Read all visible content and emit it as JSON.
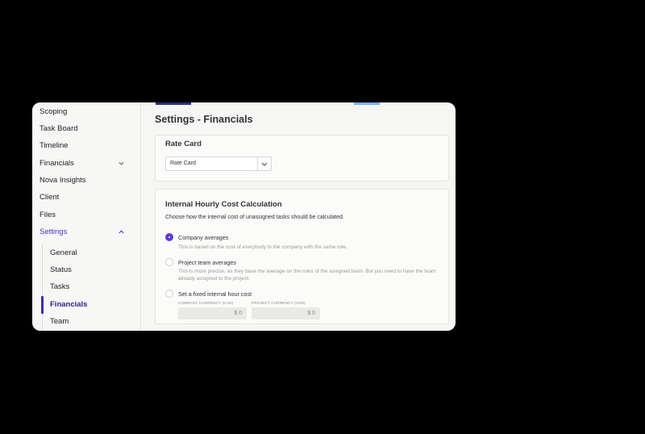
{
  "sidebar": {
    "items": [
      {
        "label": "Scoping"
      },
      {
        "label": "Task Board"
      },
      {
        "label": "Timeline"
      },
      {
        "label": "Financials"
      },
      {
        "label": "Nova Insights"
      },
      {
        "label": "Client"
      },
      {
        "label": "Files"
      },
      {
        "label": "Settings"
      }
    ],
    "sub_items": [
      {
        "label": "General"
      },
      {
        "label": "Status"
      },
      {
        "label": "Tasks"
      },
      {
        "label": "Financials"
      },
      {
        "label": "Team"
      }
    ]
  },
  "page": {
    "title": "Settings - Financials"
  },
  "rate_card": {
    "title": "Rate Card",
    "select_value": "Rate Card"
  },
  "hourly_cost": {
    "title": "Internal Hourly Cost Calculation",
    "description": "Choose how the internal cost of unassigned tasks should be calculated.",
    "options": [
      {
        "label": "Company averages",
        "help": "This is based on the cost of everybody in the company with the same role.",
        "selected": true
      },
      {
        "label": "Project team averages",
        "help": "This is more precise, as they base the average on the roles of the assigned team. But you need to have the team already assigned to the project.",
        "selected": false
      },
      {
        "label": "Set a fixed internal hour cost",
        "help": "",
        "selected": false
      }
    ],
    "company_currency_label": "COMPANY CURRENCY (CAD)",
    "project_currency_label": "PROJECT CURRENCY (USD)",
    "company_value": "$ 0",
    "project_value": "$ 0"
  },
  "colors": {
    "accent": "#5b3bd6",
    "active_nav": "#4b2fc9"
  }
}
